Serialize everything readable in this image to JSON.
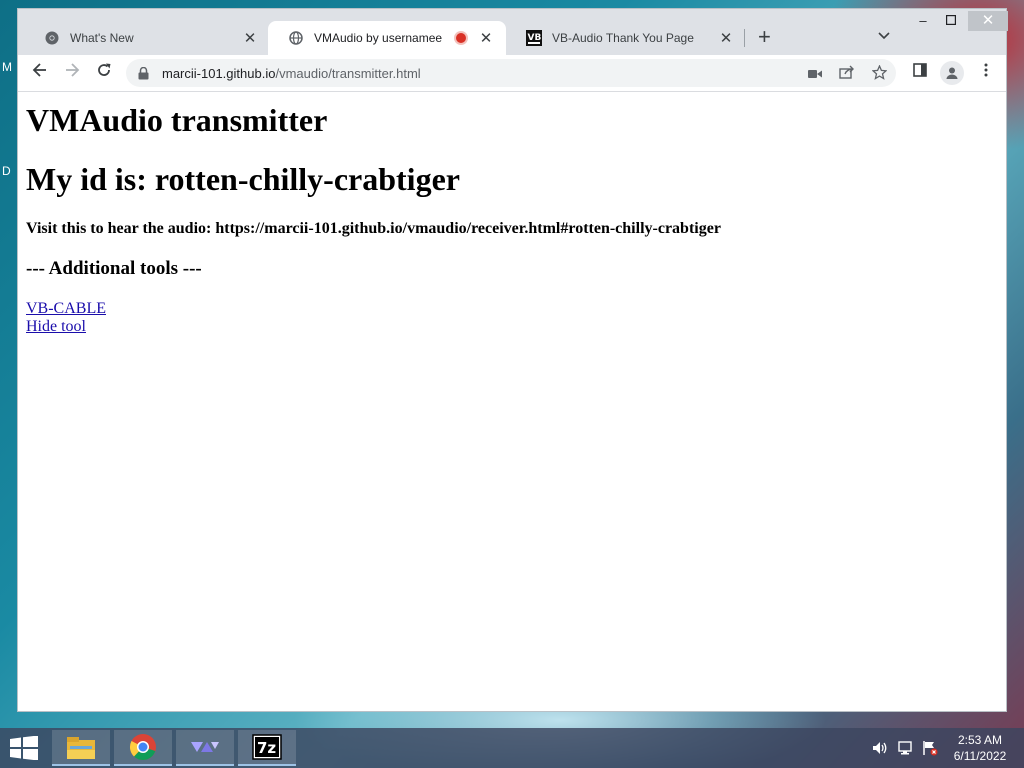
{
  "browser": {
    "tabs": [
      {
        "title": "What's New"
      },
      {
        "title": "VMAudio by usernamee"
      },
      {
        "title": "VB-Audio Thank You Page"
      }
    ],
    "address": {
      "host": "marcii-101.github.io",
      "path": "/vmaudio/transmitter.html"
    }
  },
  "page": {
    "title": "VMAudio transmitter",
    "id_heading": "My id is: rotten-chilly-crabtiger",
    "visit_text": "Visit this to hear the audio: https://marcii-101.github.io/vmaudio/receiver.html#rotten-chilly-crabtiger",
    "tools_heading": "--- Additional tools ---",
    "links": [
      "VB-CABLE",
      "Hide tool"
    ]
  },
  "desktop": {
    "edge_letters": [
      "M",
      "D"
    ]
  },
  "taskbar": {
    "apps": [
      "file-explorer",
      "chrome",
      "vmaudio-app",
      "7-zip"
    ],
    "clock_time": "2:53 AM",
    "clock_date": "6/11/2022"
  },
  "colors": {
    "tabstrip": "#dee1e6",
    "link": "#1a0dab",
    "recording": "#d93025"
  }
}
